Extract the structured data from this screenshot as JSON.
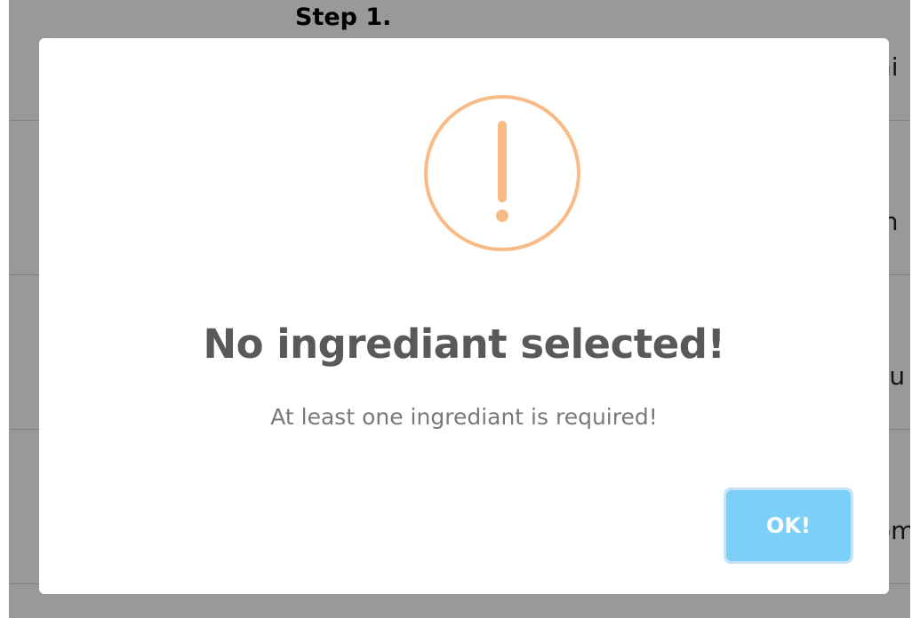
{
  "background": {
    "step_heading": "Step 1.",
    "rows": [
      {
        "text": "hi"
      },
      {
        "text": "in"
      },
      {
        "text": "cu"
      },
      {
        "text": "om"
      }
    ]
  },
  "dialog": {
    "icon": "warning-exclamation-icon",
    "title": "No ingrediant selected!",
    "text": "At least one ingrediant is required!",
    "confirm_label": "OK!"
  },
  "colors": {
    "icon": "#f8bb86",
    "confirm_button": "#7ccff6",
    "title": "#595959",
    "text": "#797979"
  }
}
